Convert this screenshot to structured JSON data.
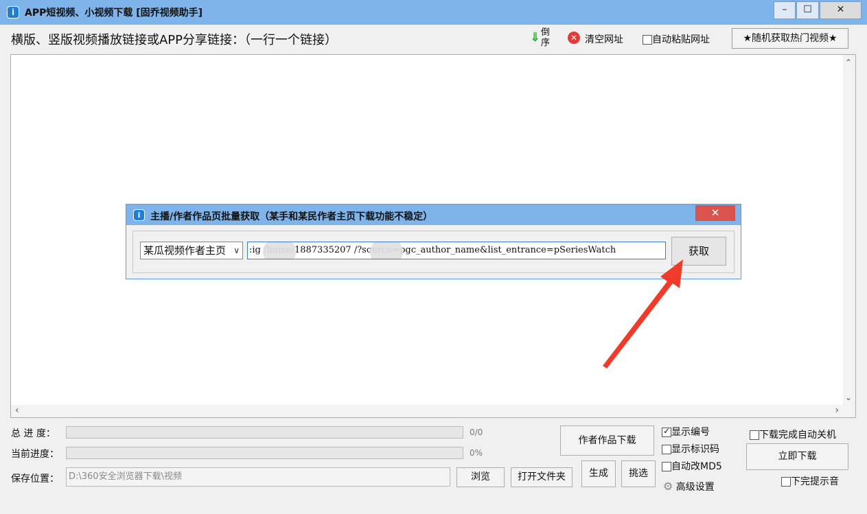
{
  "window": {
    "title": "APP短视频、小视频下载 [固乔视频助手]",
    "icon_label": "i",
    "minimize": "–",
    "maximize": "☐",
    "close": "✕"
  },
  "toolbar": {
    "prompt": "横版、竖版视频播放链接或APP分享链接：（一行一个链接）",
    "sort_icon": "⇓",
    "sort_label": "倒序",
    "clear_icon": "✕",
    "clear_label": "清空网址",
    "autopaste_label": "自动粘贴网址",
    "autopaste_checked": false,
    "hot_button": "★随机获取热门视频★"
  },
  "main": {
    "text": "",
    "scroll_up": "⌃",
    "scroll_down": "⌄",
    "scroll_left": "‹",
    "scroll_right": "›"
  },
  "dialog": {
    "title": "主播/作者作品页批量获取（某手和某民作者主页下载功能不稳定）",
    "icon_label": "i",
    "close": "✕",
    "select_value": "某瓜视频作者主页",
    "select_arrow": "∨",
    "url_value": ":ig       /home/1887335207       /?source=pgc_author_name&list_entrance=pSeriesWatch",
    "fetch_button": "获取"
  },
  "annotation": {
    "arrow_color": "#f23a2a"
  },
  "bottom": {
    "total_label": "总 进 度：",
    "total_value": "0/0",
    "current_label": "当前进度：",
    "current_value": "0%",
    "save_label": "保存位置：",
    "save_path": "D:\\360安全浏览器下载\\视频",
    "browse_button": "浏览",
    "open_folder_button": "打开文件夹",
    "author_download_button": "作者作品下载",
    "generate_button": "生成",
    "pick_button": "挑选",
    "show_number_label": "显示编号",
    "show_number_checked": true,
    "show_id_label": "显示标识码",
    "show_id_checked": false,
    "auto_md5_label": "自动改MD5",
    "auto_md5_checked": false,
    "advanced_icon": "⚙",
    "advanced_label": "高级设置",
    "shutdown_label": "下载完成自动关机",
    "shutdown_checked": false,
    "download_now_button": "立即下载",
    "done_sound_label": "下完提示音",
    "done_sound_checked": false
  }
}
